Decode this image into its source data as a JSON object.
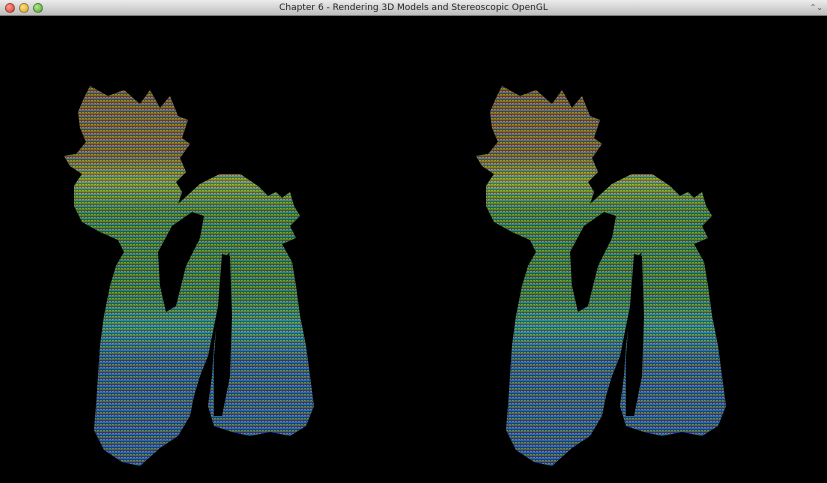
{
  "window": {
    "title": "Chapter 6 - Rendering 3D Models and Stereoscopic OpenGL",
    "controls": {
      "close_icon": "close-icon",
      "minimize_icon": "minimize-icon",
      "zoom_icon": "zoom-icon"
    },
    "resize_icon": "resize-icon",
    "resize_glyph": "⌃⌄"
  },
  "viewport": {
    "background": "#000000",
    "views": [
      {
        "name": "left-eye-view",
        "model": "dragon point cloud"
      },
      {
        "name": "right-eye-view",
        "model": "dragon point cloud"
      }
    ],
    "color_gradient": {
      "top": "#c0400a",
      "upper": "#e0e020",
      "middle": "#2e8c1e",
      "lower_middle": "#1fb5b0",
      "bottom": "#1030d0"
    }
  }
}
